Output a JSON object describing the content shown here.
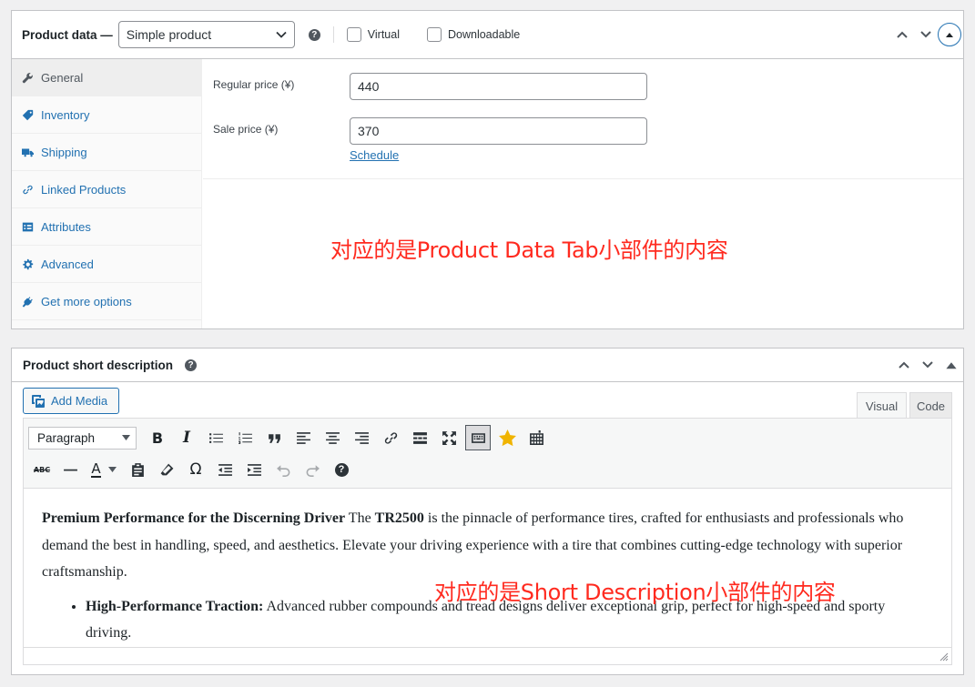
{
  "product_data": {
    "title": "Product data —",
    "type_select": "Simple product",
    "virtual_label": "Virtual",
    "downloadable_label": "Downloadable",
    "tabs": [
      {
        "label": "General"
      },
      {
        "label": "Inventory"
      },
      {
        "label": "Shipping"
      },
      {
        "label": "Linked Products"
      },
      {
        "label": "Attributes"
      },
      {
        "label": "Advanced"
      },
      {
        "label": "Get more options"
      }
    ],
    "regular_price_label": "Regular price (¥)",
    "regular_price_value": "440",
    "sale_price_label": "Sale price (¥)",
    "sale_price_value": "370",
    "schedule_link": "Schedule",
    "annotation": "对应的是Product Data Tab小部件的内容"
  },
  "short_description": {
    "title": "Product short description",
    "add_media_label": "Add Media",
    "visual_tab": "Visual",
    "code_tab": "Code",
    "format_select": "Paragraph",
    "content": {
      "heading": "Premium Performance for the Discerning Driver",
      "text_before_model": " The ",
      "model": "TR2500",
      "text_after_model": " is the pinnacle of performance tires, crafted for enthusiasts and professionals who demand the best in handling, speed, and aesthetics. Elevate your driving experience with a tire that combines cutting-edge technology with superior craftsmanship.",
      "bullet_title": "High-Performance Traction:",
      "bullet_text": " Advanced rubber compounds and tread designs deliver exceptional grip, perfect for high-speed and sporty driving."
    },
    "annotation": "对应的是Short Description小部件的内容"
  },
  "colors": {
    "link": "#2271b1",
    "annotation": "#ff2a1f",
    "border": "#c3c4c7"
  }
}
